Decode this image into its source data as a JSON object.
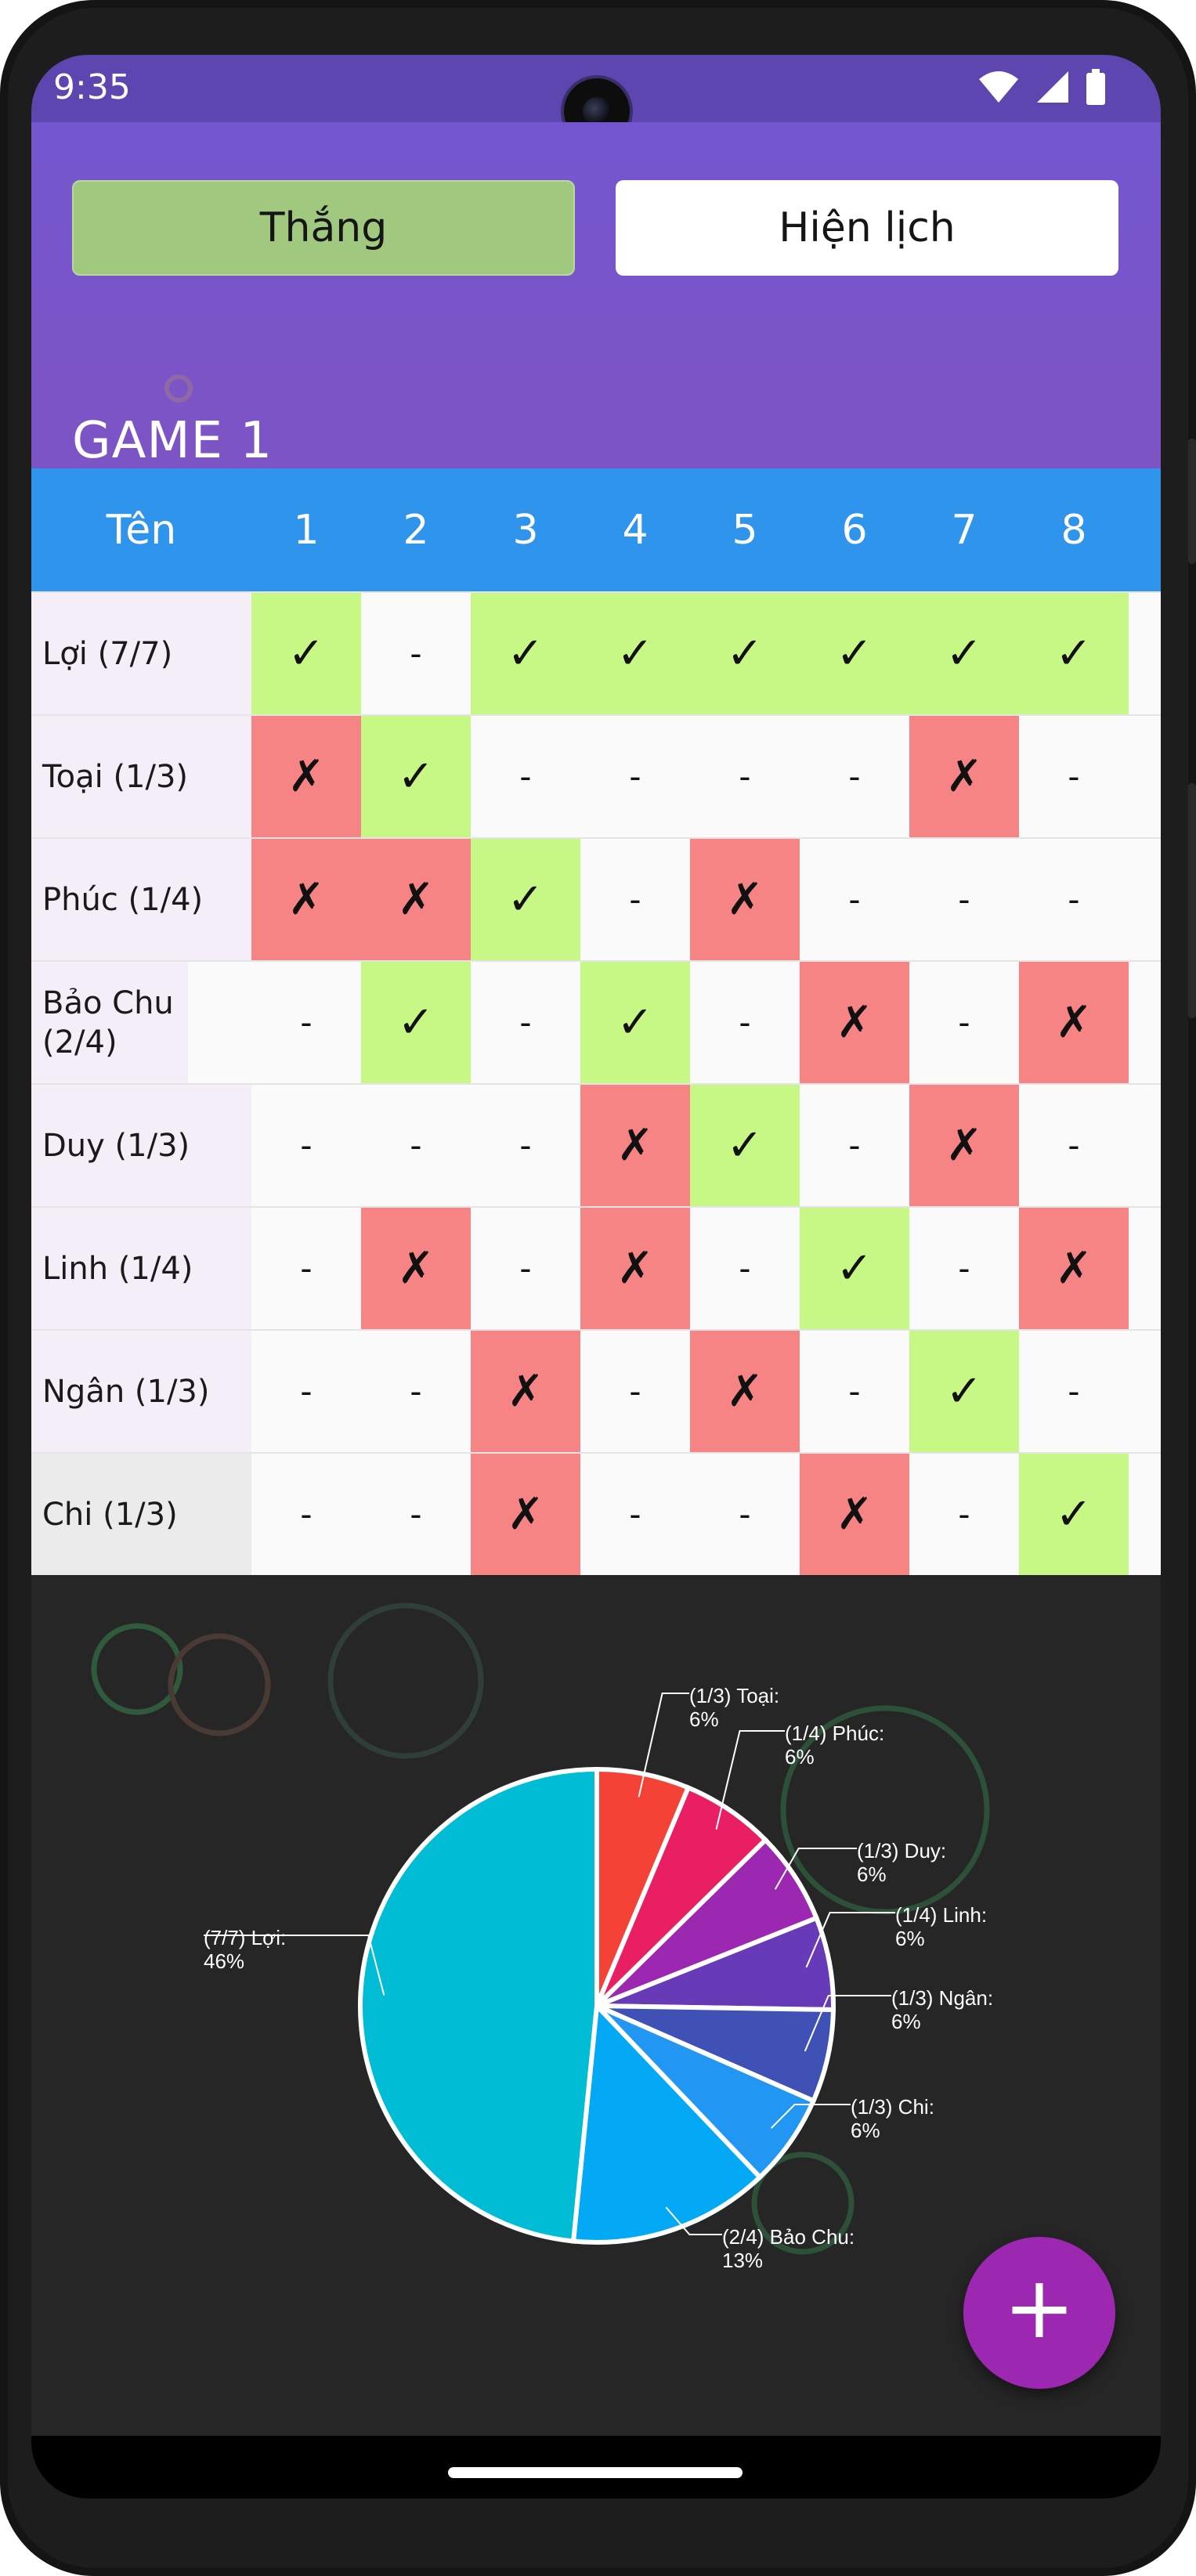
{
  "status_bar": {
    "time": "9:35"
  },
  "header": {
    "win_button": "Thắng",
    "calendar_button": "Hiện lịch",
    "game_title": "GAME 1"
  },
  "table": {
    "name_header": "Tên",
    "rounds": [
      "1",
      "2",
      "3",
      "4",
      "5",
      "6",
      "7",
      "8"
    ],
    "rows": [
      {
        "name": "Lợi (7/7)",
        "results": [
          "✓",
          "-",
          "✓",
          "✓",
          "✓",
          "✓",
          "✓",
          "✓"
        ]
      },
      {
        "name": "Toại (1/3)",
        "results": [
          "✗",
          "✓",
          "-",
          "-",
          "-",
          "-",
          "✗",
          "-"
        ]
      },
      {
        "name": "Phúc (1/4)",
        "results": [
          "✗",
          "✗",
          "✓",
          "-",
          "✗",
          "-",
          "-",
          "-"
        ]
      },
      {
        "name": "Bảo Chu (2/4)",
        "results": [
          "-",
          "✓",
          "-",
          "✓",
          "-",
          "✗",
          "-",
          "✗"
        ]
      },
      {
        "name": "Duy (1/3)",
        "results": [
          "-",
          "-",
          "-",
          "✗",
          "✓",
          "-",
          "✗",
          "-"
        ]
      },
      {
        "name": "Linh (1/4)",
        "results": [
          "-",
          "✗",
          "-",
          "✗",
          "-",
          "✓",
          "-",
          "✗"
        ]
      },
      {
        "name": "Ngân (1/3)",
        "results": [
          "-",
          "-",
          "✗",
          "-",
          "✗",
          "-",
          "✓",
          "-"
        ]
      },
      {
        "name": "Chi (1/3)",
        "results": [
          "-",
          "-",
          "✗",
          "-",
          "-",
          "✗",
          "-",
          "✓"
        ]
      }
    ]
  },
  "chart_data": {
    "type": "pie",
    "slices": [
      {
        "label": "(1/3) Toại:",
        "pct_label": "6%",
        "value": 6,
        "color": "#f44336"
      },
      {
        "label": "(1/4) Phúc:",
        "pct_label": "6%",
        "value": 6,
        "color": "#e91e63"
      },
      {
        "label": "(1/3) Duy:",
        "pct_label": "6%",
        "value": 6,
        "color": "#9c27b0"
      },
      {
        "label": "(1/4) Linh:",
        "pct_label": "6%",
        "value": 6,
        "color": "#673ab7"
      },
      {
        "label": "(1/3) Ngân:",
        "pct_label": "6%",
        "value": 6,
        "color": "#3f51b5"
      },
      {
        "label": "(1/3) Chi:",
        "pct_label": "6%",
        "value": 6,
        "color": "#2196f3"
      },
      {
        "label": "(2/4) Bảo Chu:",
        "pct_label": "13%",
        "value": 13,
        "color": "#03a9f4"
      },
      {
        "label": "(7/7) Lợi:",
        "pct_label": "46%",
        "value": 46,
        "color": "#00bcd4"
      }
    ]
  },
  "colors": {
    "accent": "#7356cf",
    "win": "#c7f784",
    "loss": "#f78484",
    "fab": "#9c27b0"
  },
  "fab": {
    "label": "+"
  }
}
